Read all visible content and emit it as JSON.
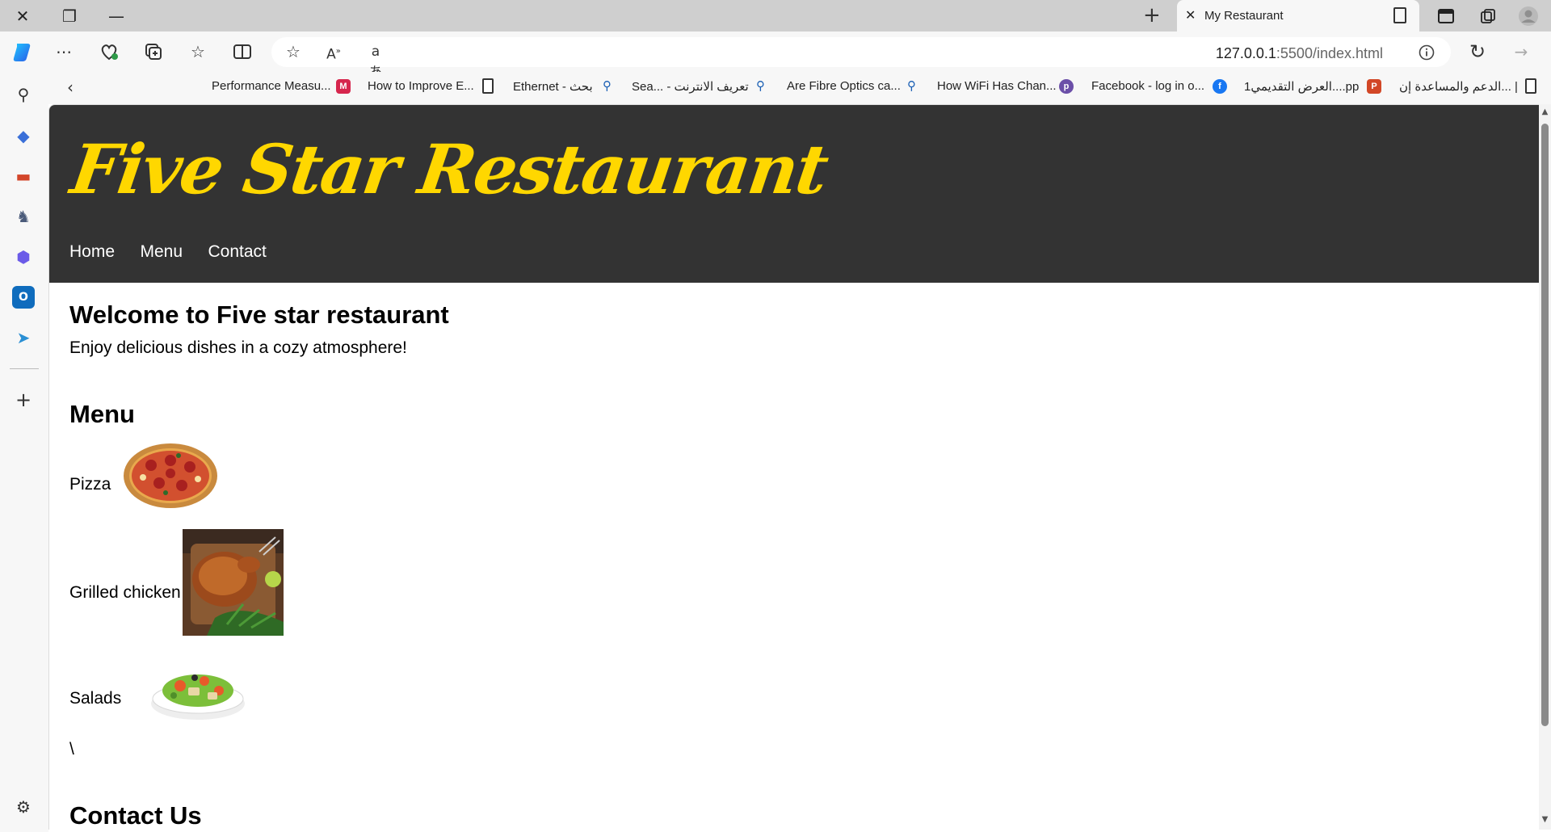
{
  "browser": {
    "tab_title": "My Restaurant",
    "address_host": "127.0.0.1",
    "address_path": ":5500/index.html"
  },
  "bookmarks": [
    {
      "label": "Performance Measu...",
      "icon": "m-logo-icon"
    },
    {
      "label": "How to Improve E...",
      "icon": "page-icon"
    },
    {
      "label": "Ethernet - بحث",
      "icon": "search-icon"
    },
    {
      "label": "Sea... - تعريف الانترنت",
      "icon": "search-icon"
    },
    {
      "label": "Are Fibre Optics ca...",
      "icon": "search-icon"
    },
    {
      "label": "How WiFi Has Chan...",
      "icon": "p-logo-icon"
    },
    {
      "label": "Facebook - log in o...",
      "icon": "facebook-icon"
    },
    {
      "label": "العرض التقديمي1....pp",
      "icon": "powerpoint-icon"
    },
    {
      "label": "الدعم والمساعدة إن... |",
      "icon": "page-icon"
    }
  ],
  "site": {
    "logo": "Five Star Restaurant",
    "nav": [
      "Home",
      "Menu",
      "Contact"
    ],
    "welcome_heading": "Welcome to Five star restaurant",
    "welcome_text": "Enjoy delicious dishes in a cozy atmosphere!",
    "menu_heading": "Menu",
    "menu_items": [
      {
        "label": "Pizza",
        "image": "pizza"
      },
      {
        "label": "Grilled chicken",
        "image": "grilled-chicken"
      },
      {
        "label": "Salads",
        "image": "salad"
      }
    ],
    "stray_text": "\\",
    "contact_heading": "Contact Us"
  },
  "colors": {
    "header_bg": "#333333",
    "logo": "#ffd700",
    "nav_text": "#ffffff"
  }
}
